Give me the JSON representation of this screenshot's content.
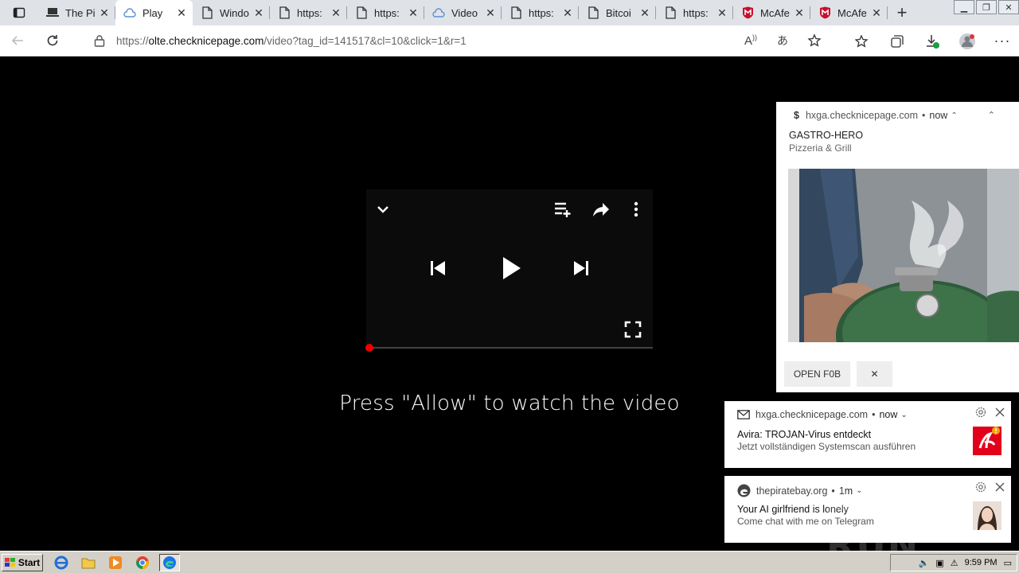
{
  "browser": {
    "tabs": [
      {
        "label": "The Pi",
        "icon": "laptop-icon",
        "active": false
      },
      {
        "label": "Play",
        "icon": "cloud-icon",
        "active": true
      },
      {
        "label": "Windo",
        "icon": "page-icon",
        "active": false
      },
      {
        "label": "https:",
        "icon": "page-icon",
        "active": false
      },
      {
        "label": "https:",
        "icon": "page-icon",
        "active": false
      },
      {
        "label": "Video",
        "icon": "cloud-icon",
        "active": false
      },
      {
        "label": "https:",
        "icon": "page-icon",
        "active": false
      },
      {
        "label": "Bitcoi",
        "icon": "page-icon",
        "active": false
      },
      {
        "label": "https:",
        "icon": "page-icon",
        "active": false
      },
      {
        "label": "McAfe",
        "icon": "mcafee-icon",
        "active": false
      },
      {
        "label": "McAfe",
        "icon": "mcafee-icon",
        "active": false
      }
    ],
    "url_prefix": "https://",
    "url_host": "olte.checknicepage.com",
    "url_path": "/video?tag_id=141517&cl=10&click=1&r=1",
    "colors": {
      "tabbar": "#dfe3e8",
      "mcafee_red": "#c8102e",
      "edge_blue": "#1a73e8"
    }
  },
  "page": {
    "press_message": "Press \"Allow\" to watch the video",
    "progress": 0.0
  },
  "notification_big": {
    "site": "hxga.checknicepage.com",
    "time": "now",
    "title": "GASTRO-HERO",
    "body": "Pizzeria & Grill",
    "button_open": "OPEN F0B",
    "button_close": "✕"
  },
  "notification_avira": {
    "site": "hxga.checknicepage.com",
    "time": "now",
    "title": "Avira: TROJAN-Virus entdeckt",
    "body": "Jetzt vollständigen Systemscan ausführen",
    "accent": "#e2001a"
  },
  "notification_piratebay": {
    "site": "thepiratebay.org",
    "time": "1m",
    "title": "Your AI girlfriend is lonely",
    "body": "Come chat with me on Telegram"
  },
  "watermark": "ANY RUN",
  "taskbar": {
    "start_label": "Start",
    "clock": "9:59 PM"
  }
}
